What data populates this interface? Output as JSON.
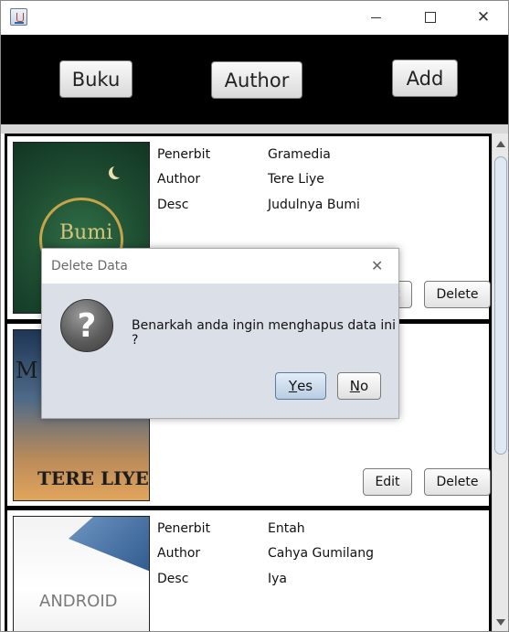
{
  "window": {
    "title": ""
  },
  "toolbar": {
    "buku_label": "Buku",
    "author_label": "Author",
    "add_label": "Add"
  },
  "books": [
    {
      "penerbit_label": "Penerbit",
      "penerbit": "Gramedia",
      "author_label": "Author",
      "author": "Tere Liye",
      "desc_label": "Desc",
      "desc": "Judulnya Bumi",
      "cover_text": "Bumi",
      "edit_label": "Edit",
      "delete_label": "Delete"
    },
    {
      "cover_text": "TERE LIYE",
      "cover_top_text": "M",
      "edit_label": "Edit",
      "delete_label": "Delete"
    },
    {
      "penerbit_label": "Penerbit",
      "penerbit": "Entah",
      "author_label": "Author",
      "author": "Cahya Gumilang",
      "desc_label": "Desc",
      "desc": "Iya",
      "cover_text": "ANDROID"
    }
  ],
  "dialog": {
    "title": "Delete Data",
    "message": "Benarkah anda ingin menghapus data ini ?",
    "yes_label": "Yes",
    "no_label": "No",
    "icon": "question-icon"
  },
  "colors": {
    "toolbar_bg": "#000000",
    "dialog_bg": "#dbe0e8"
  }
}
